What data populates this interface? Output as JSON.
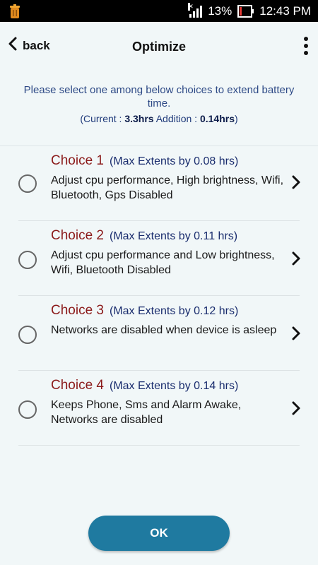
{
  "status_bar": {
    "app_icon": "trash-can-icon",
    "signal_icon": "signal-icon",
    "battery_percent": "13%",
    "battery_icon": "battery-low-icon",
    "time": "12:43 PM"
  },
  "header": {
    "back_label": "back",
    "title": "Optimize",
    "menu_icon": "more-vertical-icon"
  },
  "intro": {
    "message": "Please select one among below choices to extend battery time.",
    "current_label": "(Current : ",
    "current_value": "3.3hrs",
    "addition_label": " Addition : ",
    "addition_value": "0.14hrs",
    "close_paren": ")"
  },
  "choices": [
    {
      "title": "Choice 1",
      "max": "(Max Extents by 0.08 hrs)",
      "description": "Adjust cpu performance, High brightness, Wifi, Bluetooth, Gps Disabled",
      "selected": false
    },
    {
      "title": "Choice 2",
      "max": "(Max Extents by 0.11 hrs)",
      "description": "Adjust cpu performance and Low brightness, Wifi, Bluetooth Disabled",
      "selected": false
    },
    {
      "title": "Choice 3",
      "max": "(Max Extents by 0.12 hrs)",
      "description": "Networks are disabled when device is asleep",
      "selected": false
    },
    {
      "title": "Choice 4",
      "max": "(Max Extents by 0.14 hrs)",
      "description": "Keeps Phone, Sms and Alarm Awake, Networks are disabled",
      "selected": false
    }
  ],
  "ok_label": "OK",
  "colors": {
    "background": "#f1f7f8",
    "choice_title": "#8b1a1a",
    "max_text": "#1a2d6e",
    "intro_text": "#2e4a86",
    "ok_button": "#1f7aa0"
  }
}
